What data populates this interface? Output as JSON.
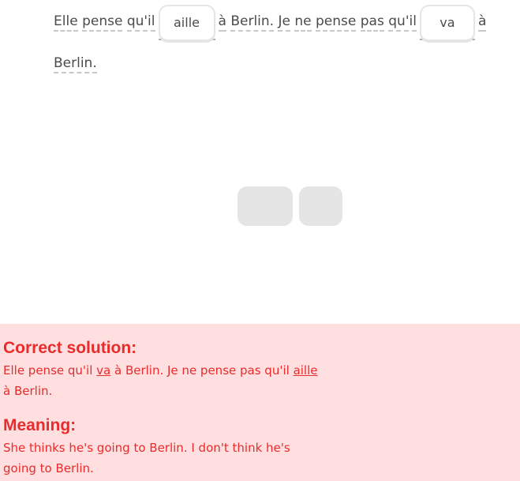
{
  "sentence": {
    "w1": "Elle",
    "w2": "pense",
    "w3": "qu'il",
    "chip1": "aille",
    "w4": "à",
    "w5": "Berlin.",
    "w6": "Je",
    "w7": "ne",
    "w8": "pense",
    "w9": "pas",
    "w10": "qu'il",
    "chip2": "va",
    "w11": "à",
    "w12": "Berlin."
  },
  "feedback": {
    "solution_title": "Correct solution:",
    "solution_part1": "Elle pense qu'il ",
    "solution_underlined1": "va",
    "solution_part2": " à Berlin. Je ne pense pas qu'il ",
    "solution_underlined2": "aille",
    "solution_part3": " à Berlin.",
    "meaning_title": "Meaning:",
    "meaning_text": "She thinks he's going to Berlin. I don't think he's going to Berlin."
  },
  "colors": {
    "feedback_bg": "#ffdfe0",
    "feedback_text": "#ea2b2b"
  }
}
